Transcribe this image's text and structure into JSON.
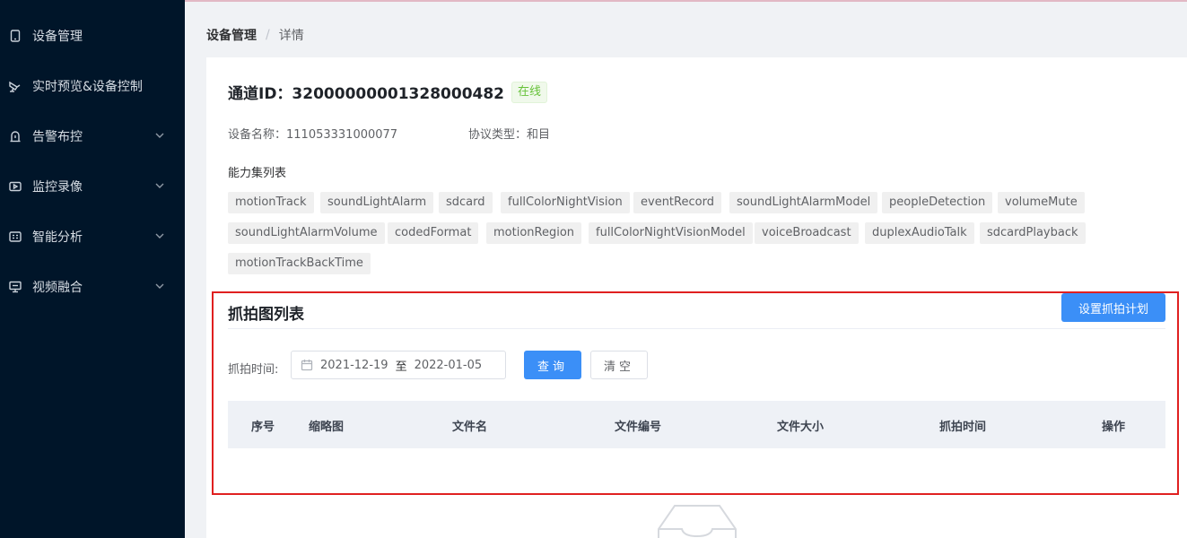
{
  "sidebar": {
    "items": [
      {
        "label": "设备管理",
        "icon": "tablet-icon",
        "has_arrow": false
      },
      {
        "label": "实时预览&设备控制",
        "icon": "camera-icon",
        "has_arrow": false
      },
      {
        "label": "告警布控",
        "icon": "alarm-icon",
        "has_arrow": true
      },
      {
        "label": "监控录像",
        "icon": "video-icon",
        "has_arrow": true
      },
      {
        "label": "智能分析",
        "icon": "analysis-icon",
        "has_arrow": true
      },
      {
        "label": "视频融合",
        "icon": "screen-icon",
        "has_arrow": true
      }
    ]
  },
  "breadcrumb": {
    "parent": "设备管理",
    "separator": "/",
    "current": "详情"
  },
  "channel": {
    "title": "通道ID：32000000001328000482",
    "status": "在线",
    "device_name_label": "设备名称：",
    "device_name": "111053331000077",
    "protocol_label": "协议类型：",
    "protocol": "和目"
  },
  "capabilities": {
    "title": "能力集列表",
    "tags": [
      "motionTrack",
      "soundLightAlarm",
      "sdcard",
      "fullColorNightVision",
      "eventRecord",
      "soundLightAlarmModel",
      "peopleDetection",
      "volumeMute",
      "soundLightAlarmVolume",
      "codedFormat",
      "motionRegion",
      "fullColorNightVisionModel",
      "voiceBroadcast",
      "duplexAudioTalk",
      "sdcardPlayback",
      "motionTrackBackTime"
    ]
  },
  "snapshots": {
    "title": "抓拍图列表",
    "plan_button": "设置抓拍计划",
    "filter_label": "抓拍时间:",
    "date_start": "2021-12-19",
    "date_to": "至",
    "date_end": "2022-01-05",
    "query_button": "查询",
    "clear_button": "清空",
    "columns": [
      "序号",
      "缩略图",
      "文件名",
      "文件编号",
      "文件大小",
      "抓拍时间",
      "操作"
    ]
  },
  "colors": {
    "sidebar_bg": "#001529",
    "primary": "#3b8ff7",
    "online": "#67c23a",
    "highlight": "#e02020"
  }
}
